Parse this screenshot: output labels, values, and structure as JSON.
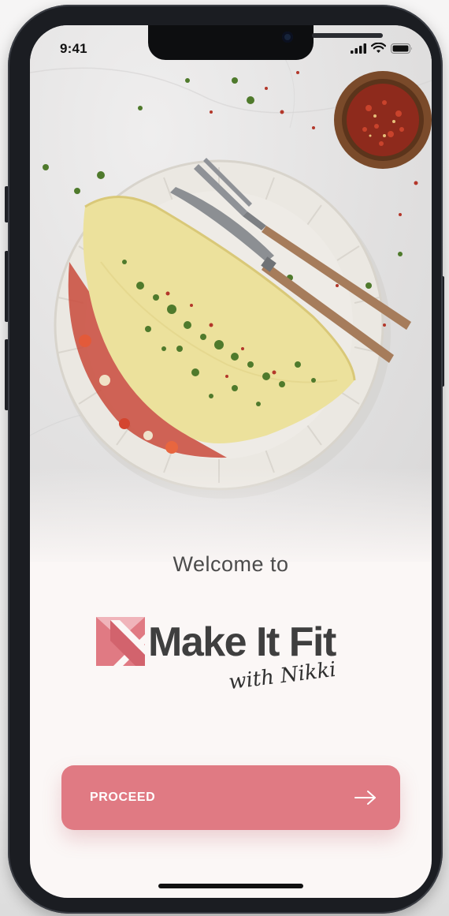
{
  "status_bar": {
    "time": "9:41",
    "icons": [
      "cellular-signal-icon",
      "wifi-icon",
      "battery-icon"
    ]
  },
  "hero": {
    "image": "omelette-plate-with-fork-knife-and-chili-flakes-bowl"
  },
  "welcome": {
    "heading": "Welcome to"
  },
  "logo": {
    "brand": "Make It Fit",
    "tagline": "with Nikki",
    "mark_icon": "envelope-k-logo-icon"
  },
  "proceed_button": {
    "label": "PROCEED",
    "icon": "arrow-right-icon"
  },
  "colors": {
    "accent": "#e07a83",
    "accent_light": "#f0b4ba",
    "text_dark": "#3f3f3f",
    "background": "#fbf7f6"
  }
}
